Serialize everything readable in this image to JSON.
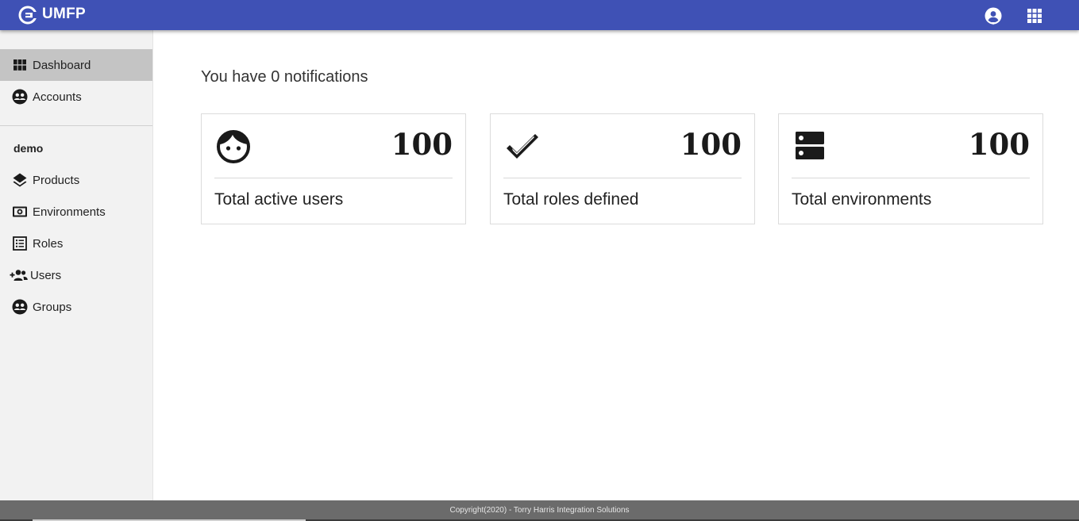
{
  "app": {
    "title": "UMFP",
    "accent_color": "#3f51b5"
  },
  "topbar": {
    "icons": [
      "account-circle-icon",
      "apps-grid-icon"
    ]
  },
  "sidebar": {
    "items": [
      {
        "label": "Dashboard",
        "icon": "dashboard-grid-icon",
        "active": true
      },
      {
        "label": "Accounts",
        "icon": "group-icon",
        "active": false
      }
    ],
    "section_label": "demo",
    "section_items": [
      {
        "label": "Products",
        "icon": "layers-icon"
      },
      {
        "label": "Environments",
        "icon": "environment-icon"
      },
      {
        "label": "Roles",
        "icon": "list-icon"
      },
      {
        "label": "Users",
        "icon": "add-users-icon"
      },
      {
        "label": "Groups",
        "icon": "group-icon"
      }
    ]
  },
  "main": {
    "notification_text": "You have 0 notifications",
    "cards": [
      {
        "value": "100",
        "label": "Total active users",
        "icon": "face-icon"
      },
      {
        "value": "100",
        "label": "Total roles defined",
        "icon": "double-check-icon"
      },
      {
        "value": "100",
        "label": "Total environments",
        "icon": "storage-icon"
      }
    ]
  },
  "footer": {
    "text": "Copyright(2020) - Torry Harris Integration Solutions"
  }
}
